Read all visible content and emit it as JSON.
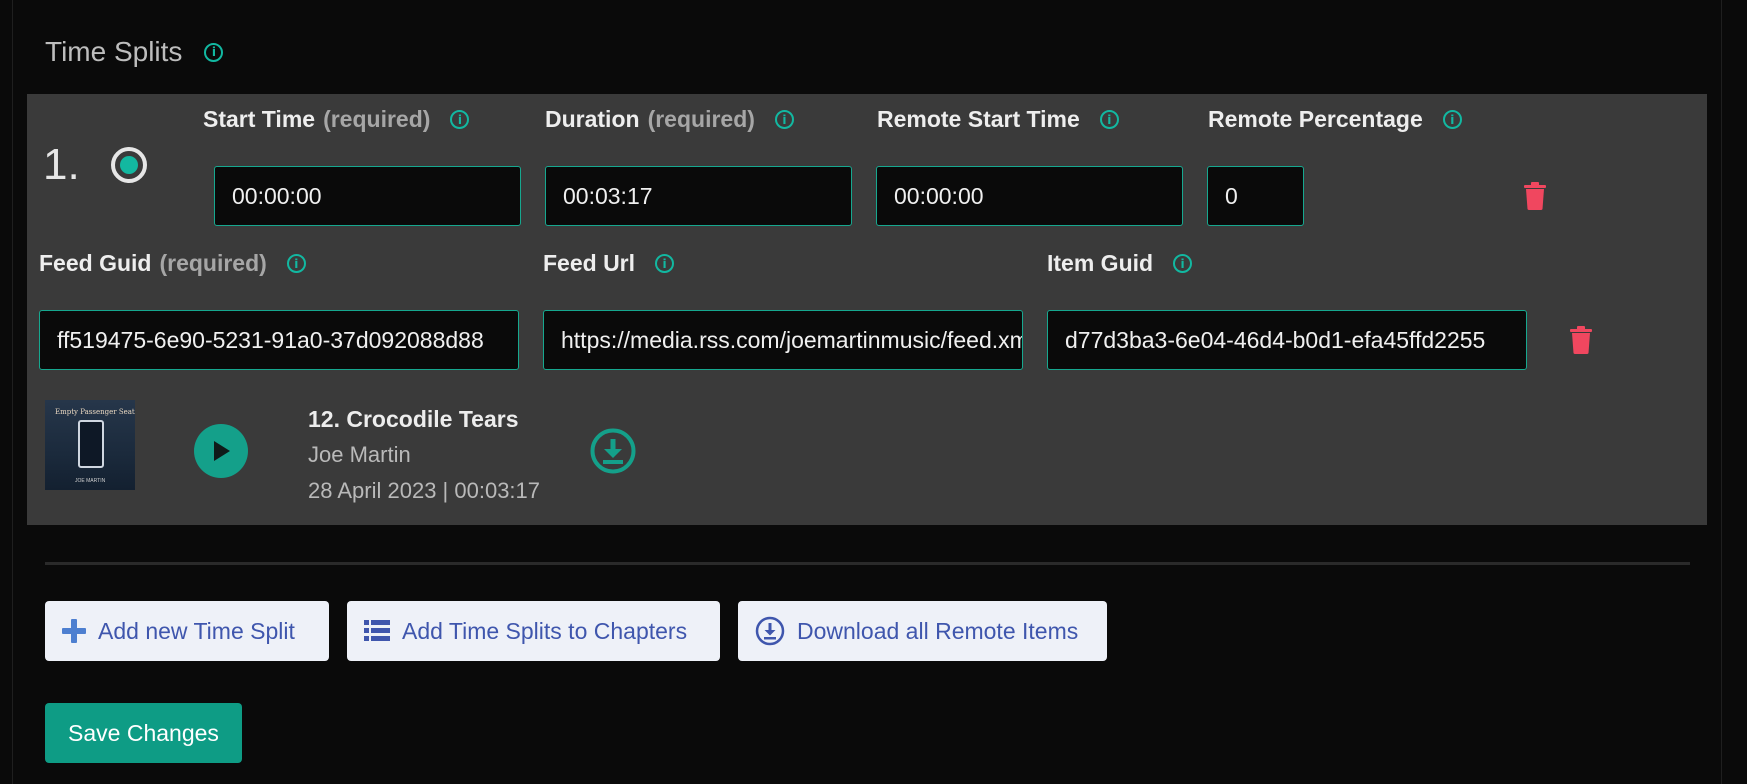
{
  "section": {
    "title": "Time Splits"
  },
  "split": {
    "number": "1.",
    "start_time": {
      "label": "Start Time",
      "req": "(required)",
      "value": "00:00:00"
    },
    "duration": {
      "label": "Duration",
      "req": "(required)",
      "value": "00:03:17"
    },
    "remote_start": {
      "label": "Remote Start Time",
      "value": "00:00:00"
    },
    "remote_percentage": {
      "label": "Remote Percentage",
      "value": "0"
    },
    "feed_guid": {
      "label": "Feed Guid",
      "req": "(required)",
      "value": "ff519475-6e90-5231-91a0-37d092088d88"
    },
    "feed_url": {
      "label": "Feed Url",
      "value": "https://media.rss.com/joemartinmusic/feed.xml"
    },
    "item_guid": {
      "label": "Item Guid",
      "value": "d77d3ba3-6e04-46d4-b0d1-efa45ffd2255"
    },
    "track": {
      "title": "12. Crocodile Tears",
      "artist": "Joe Martin",
      "meta": "28 April 2023 | 00:03:17",
      "cover_text_top": "Empty Passenger Seat",
      "cover_text_bottom": "JOE MARTIN"
    }
  },
  "buttons": {
    "add_split": "Add new Time Split",
    "add_chapters": "Add Time Splits to Chapters",
    "download_all": "Download all Remote Items",
    "save": "Save Changes"
  },
  "colors": {
    "accent": "#13b8a0",
    "danger": "#f0475f",
    "card_bg": "#3a3a3a",
    "button_text": "#3f56ad"
  },
  "icons": {
    "info": "info-circle-icon",
    "trash": "trash-icon",
    "play": "play-icon",
    "download": "download-circle-icon",
    "plus": "plus-icon",
    "list": "list-icon"
  }
}
